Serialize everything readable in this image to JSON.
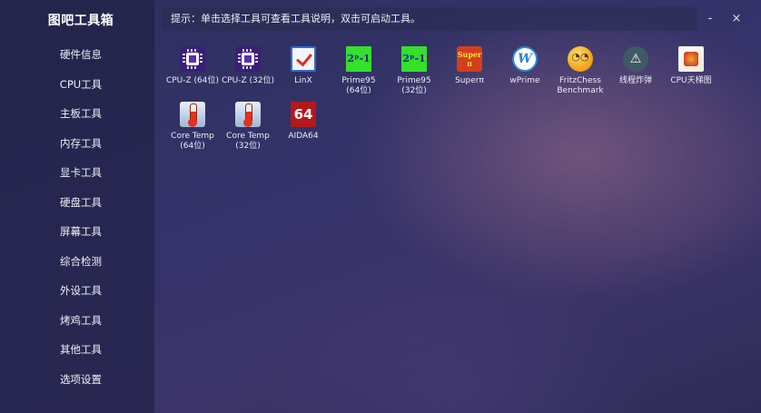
{
  "app": {
    "title": "图吧工具箱",
    "hint": "提示：单击选择工具可查看工具说明，双击可启动工具。",
    "minimize_glyph": "-",
    "close_glyph": "×"
  },
  "sidebar": {
    "items": [
      {
        "label": "硬件信息"
      },
      {
        "label": "CPU工具"
      },
      {
        "label": "主板工具"
      },
      {
        "label": "内存工具"
      },
      {
        "label": "显卡工具"
      },
      {
        "label": "硬盘工具"
      },
      {
        "label": "屏幕工具"
      },
      {
        "label": "综合检测"
      },
      {
        "label": "外设工具"
      },
      {
        "label": "烤鸡工具"
      },
      {
        "label": "其他工具"
      },
      {
        "label": "选项设置"
      }
    ]
  },
  "tools": [
    {
      "label": "CPU-Z (64位)",
      "icon": "cpuz-icon",
      "glyph": ""
    },
    {
      "label": "CPU-Z (32位)",
      "icon": "cpuz-icon",
      "glyph": ""
    },
    {
      "label": "LinX",
      "icon": "linx-icon",
      "glyph": ""
    },
    {
      "label": "Prime95\n(64位)",
      "icon": "prime95-icon",
      "glyph": "2ᵖ-1"
    },
    {
      "label": "Prime95\n(32位)",
      "icon": "prime95-icon",
      "glyph": "2ᵖ-1"
    },
    {
      "label": "Superπ",
      "icon": "superpi-icon",
      "glyph": "Super\nπ"
    },
    {
      "label": "wPrime",
      "icon": "wprime-icon",
      "glyph": "W"
    },
    {
      "label": "FritzChess\nBenchmark",
      "icon": "fritzchess-icon",
      "glyph": "◔◔"
    },
    {
      "label": "线程炸弹",
      "icon": "warning-icon",
      "glyph": "⚠"
    },
    {
      "label": "CPU天梯图",
      "icon": "cpu-ladder-icon",
      "glyph": ""
    },
    {
      "label": "Core Temp\n(64位)",
      "icon": "coretemp-icon",
      "glyph": ""
    },
    {
      "label": "Core Temp\n(32位)",
      "icon": "coretemp-icon",
      "glyph": ""
    },
    {
      "label": "AIDA64",
      "icon": "aida64-icon",
      "glyph": "64"
    }
  ]
}
